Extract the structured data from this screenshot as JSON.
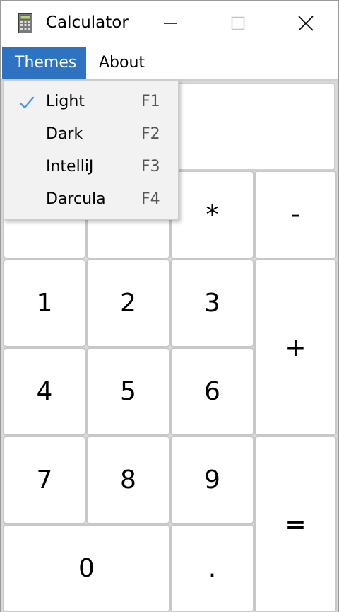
{
  "window": {
    "title": "Calculator",
    "icon": "calculator-icon",
    "controls": [
      "minimize-icon",
      "maximize-icon",
      "close-icon"
    ]
  },
  "menu": {
    "themes_label": "Themes",
    "about_label": "About",
    "active_color": "#2d73c2"
  },
  "dropdown": {
    "items": [
      {
        "label": "Light",
        "shortcut": "F1",
        "checked": true
      },
      {
        "label": "Dark",
        "shortcut": "F2",
        "checked": false
      },
      {
        "label": "IntelliJ",
        "shortcut": "F3",
        "checked": false
      },
      {
        "label": "Darcula",
        "shortcut": "F4",
        "checked": false
      }
    ],
    "check_color": "#4a9be0"
  },
  "display": {
    "value": ""
  },
  "keys": {
    "mul": "*",
    "minus": "-",
    "plus": "+",
    "equals": "=",
    "dot": ".",
    "d0": "0",
    "d1": "1",
    "d2": "2",
    "d3": "3",
    "d4": "4",
    "d5": "5",
    "d6": "6",
    "d7": "7",
    "d8": "8",
    "d9": "9"
  }
}
